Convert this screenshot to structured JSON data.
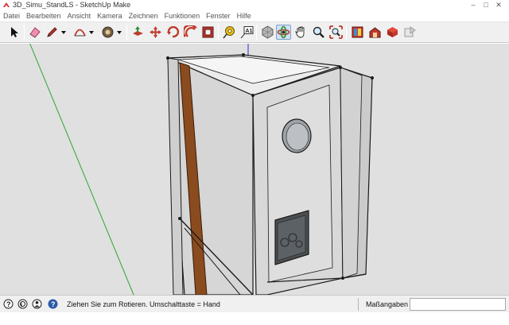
{
  "window": {
    "title": "3D_Simu_StandLS - SketchUp Make",
    "app_icon": "sketchup-logo-icon"
  },
  "window_controls": [
    "minimize-icon",
    "maximize-icon",
    "close-icon"
  ],
  "menu": [
    "Datei",
    "Bearbeiten",
    "Ansicht",
    "Kamera",
    "Zeichnen",
    "Funktionen",
    "Fenster",
    "Hilfe"
  ],
  "toolbar": {
    "tools": [
      "select-arrow-icon",
      "eraser-icon",
      "pencil-line-icon",
      "arc-icon",
      "paint-bucket-icon",
      "push-pull-icon",
      "move-icon",
      "rotate-icon",
      "offset-icon",
      "tape-measure-icon",
      "text-label-icon",
      "orbit-icon",
      "pan-hand-icon",
      "zoom-icon",
      "zoom-extents-icon",
      "3d-warehouse-icon",
      "extension-warehouse-icon",
      "components-icon",
      "share-model-icon"
    ],
    "active_tool": "orbit-icon"
  },
  "statusbar": {
    "icons": [
      "geolocation-icon",
      "credits-icon",
      "user-icon",
      "help-icon"
    ],
    "hint": "Ziehen Sie zum Rotieren.  Umschalttaste = Hand",
    "measurements_label": "Maßangaben",
    "measurements_value": ""
  },
  "colors": {
    "viewport_background": "#e0e0e0",
    "face": "#d7d7d7",
    "face_light": "#ececec",
    "wood_strip": "#8a4b1f",
    "edge": "#1a1a1a",
    "green_axis": "#2fa52f",
    "blue_axis": "#2b2bd0"
  }
}
